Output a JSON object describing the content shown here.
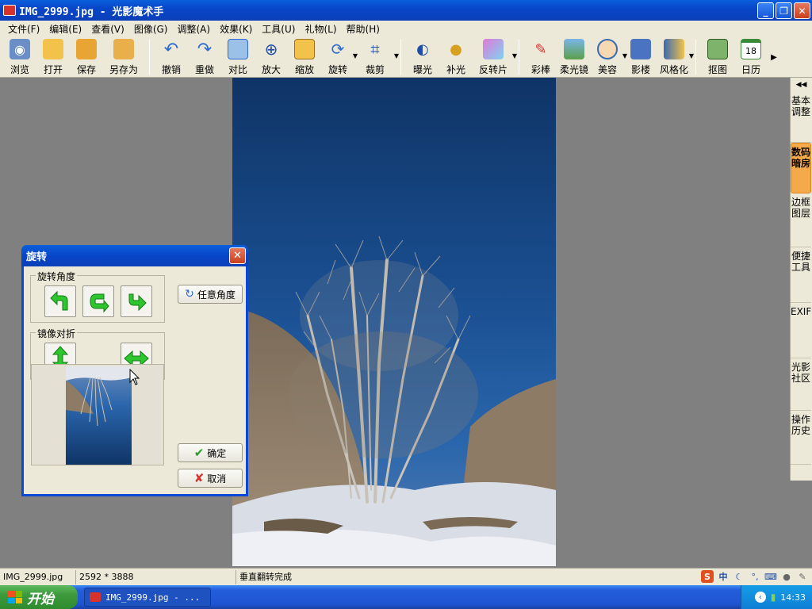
{
  "window": {
    "title": "IMG_2999.jpg - 光影魔术手",
    "minimize": "_",
    "restore": "❐",
    "close": "✕"
  },
  "menu": [
    "文件(F)",
    "编辑(E)",
    "查看(V)",
    "图像(G)",
    "调整(A)",
    "效果(K)",
    "工具(U)",
    "礼物(L)",
    "帮助(H)"
  ],
  "toolbar": {
    "browse": "浏览",
    "open": "打开",
    "save": "保存",
    "save_as": "另存为",
    "undo": "撤销",
    "redo": "重做",
    "compare": "对比",
    "zoom_in": "放大",
    "resize": "缩放",
    "rotate": "旋转",
    "crop": "裁剪",
    "exposure": "曝光",
    "fill_light": "补光",
    "invert": "反转片",
    "color_pen": "彩棒",
    "soft_focus": "柔光镜",
    "beauty": "美容",
    "studio": "影楼",
    "stylize": "风格化",
    "cutout": "抠图",
    "calendar": "日历",
    "calendar_day": "18"
  },
  "sidepanel": {
    "tabs": [
      "基本调整",
      "数码暗房",
      "边框图层",
      "便捷工具",
      "EXIF",
      "光影社区",
      "操作历史"
    ],
    "active": 1
  },
  "dialog": {
    "title": "旋转",
    "rotate_group": "旋转角度",
    "mirror_group": "镜像对折",
    "arbitrary_label": "任意角度",
    "ok_label": "确定",
    "cancel_label": "取消"
  },
  "status": {
    "filename": "IMG_2999.jpg",
    "dimensions": "2592 * 3888",
    "message": "垂直翻转完成"
  },
  "taskbar": {
    "start_label": "开始",
    "task_label": "IMG_2999.jpg - ...",
    "time": "14:33"
  },
  "colors": {
    "xp_blue": "#0a48d8",
    "face": "#ece9d8",
    "arrow_green": "#2fc52f"
  }
}
